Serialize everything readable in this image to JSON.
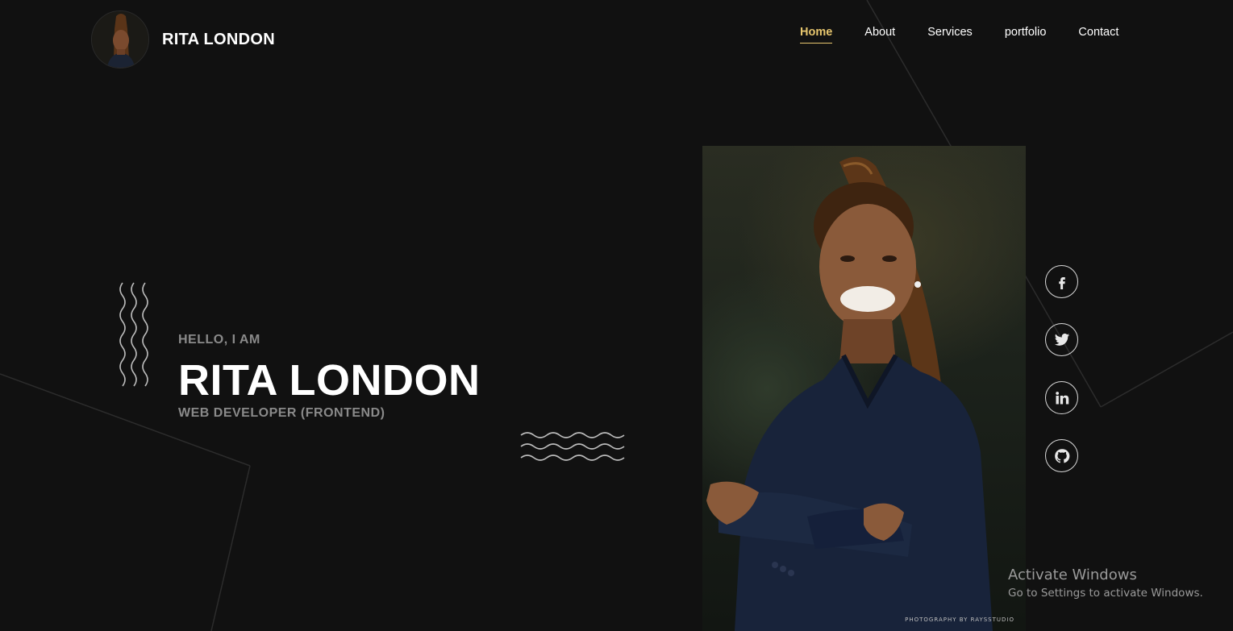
{
  "header": {
    "brand_name": "RITA LONDON",
    "nav": [
      {
        "label": "Home",
        "active": true
      },
      {
        "label": "About",
        "active": false
      },
      {
        "label": "Services",
        "active": false
      },
      {
        "label": "portfolio",
        "active": false
      },
      {
        "label": "Contact",
        "active": false
      }
    ]
  },
  "hero": {
    "greeting": "HELLO, I AM",
    "name": "RITA LONDON",
    "role": "WEB DEVELOPER (FRONTEND)"
  },
  "photo": {
    "credit": "PHOTOGRAPHY BY RAYSSTUDIO"
  },
  "socials": [
    {
      "icon": "facebook-icon"
    },
    {
      "icon": "twitter-icon"
    },
    {
      "icon": "linkedin-icon"
    },
    {
      "icon": "github-icon"
    }
  ],
  "watermark": {
    "title": "Activate Windows",
    "subtitle": "Go to Settings to activate Windows."
  },
  "colors": {
    "background": "#111111",
    "accent": "#e7c66e",
    "muted_text": "#8a8a8a"
  }
}
